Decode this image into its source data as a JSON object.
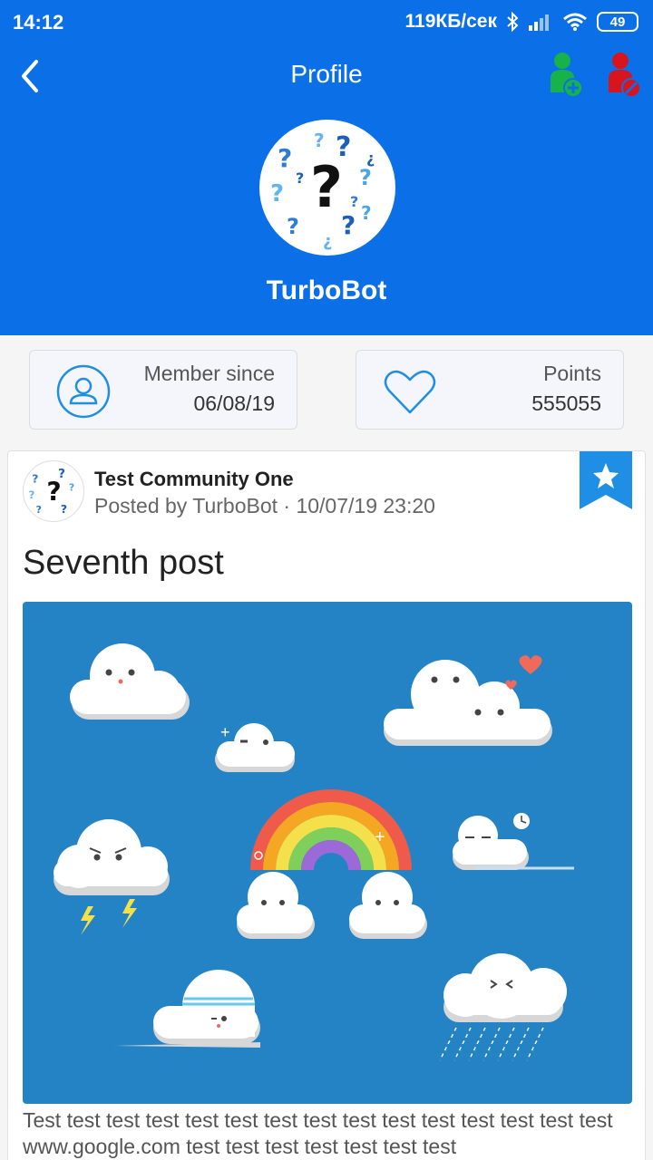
{
  "status_bar": {
    "time": "14:12",
    "network_speed": "119КБ/сек",
    "battery": "49"
  },
  "header": {
    "title": "Profile",
    "back_icon": "chevron-left-icon",
    "add_friend_icon": "add-user-icon",
    "block_user_icon": "block-user-icon",
    "background_color": "#0b6fe8"
  },
  "profile": {
    "username": "TurboBot",
    "avatar_icon": "question-marks-avatar"
  },
  "stats": {
    "member_label": "Member since",
    "member_value": "06/08/19",
    "points_label": "Points",
    "points_value": "555055"
  },
  "post": {
    "community": "Test Community One",
    "posted_by": "Posted by TurboBot · 10/07/19 23:20",
    "title": "Seventh post",
    "image_icon": "cute-clouds-illustration",
    "body": "Test test test test test test test test test test test test test test test www.google.com test test test test test test test",
    "bookmark_icon": "star-bookmark-icon"
  },
  "colors": {
    "accent": "#0b6fe8",
    "bookmark": "#1f8fe6",
    "add_user": "#18b24a",
    "block_user": "#d8141c",
    "image_bg": "#2383c4"
  }
}
